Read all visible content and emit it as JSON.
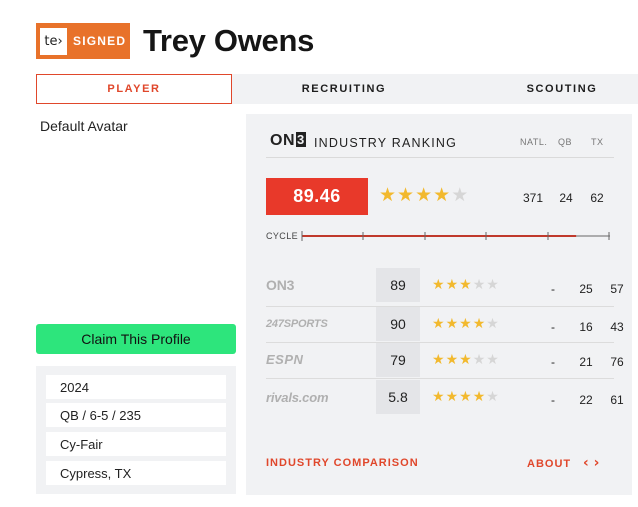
{
  "header": {
    "badge_logo": "te›",
    "badge_text": "SIGNED",
    "player_name": "Trey Owens"
  },
  "tabs": [
    {
      "label": "PLAYER",
      "active": true
    },
    {
      "label": "RECRUITING",
      "active": false
    },
    {
      "label": "SCOUTING",
      "active": false
    }
  ],
  "profile": {
    "avatar_label": "Default Avatar",
    "claim_label": "Claim This Profile",
    "bio": [
      "2024",
      "QB / 6-5 / 235",
      "Cy-Fair",
      "Cypress, TX"
    ]
  },
  "ranking": {
    "logo": "ON3",
    "title": "INDUSTRY RANKING",
    "columns": [
      "NATL.",
      "QB",
      "TX"
    ],
    "score": "89.46",
    "stars": 4,
    "natl": "371",
    "pos": "24",
    "state": "62",
    "cycle_label": "CYCLE",
    "cycle_progress": 0.89,
    "sources": [
      {
        "name": "ON3",
        "score": "89",
        "stars": 3,
        "natl": "-",
        "pos": "25",
        "state": "57"
      },
      {
        "name": "247SPORTS",
        "score": "90",
        "stars": 4,
        "natl": "-",
        "pos": "16",
        "state": "43"
      },
      {
        "name": "ESPN",
        "score": "79",
        "stars": 3,
        "natl": "-",
        "pos": "21",
        "state": "76"
      },
      {
        "name": "rivals.com",
        "score": "5.8",
        "stars": 4,
        "natl": "-",
        "pos": "22",
        "state": "61"
      }
    ],
    "industry_comparison_label": "INDUSTRY COMPARISON",
    "about_label": "ABOUT",
    "about_icon": "‹ ›"
  },
  "colors": {
    "accent": "#e0472b",
    "score_bg": "#e8392a",
    "claim_bg": "#2de57c",
    "badge_bg": "#e8722a",
    "star_on": "#f2b92e",
    "star_off": "#d6d6d6"
  }
}
